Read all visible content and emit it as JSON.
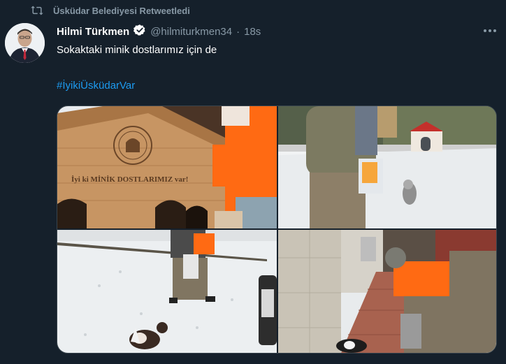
{
  "retweet": {
    "label": "Üsküdar Belediyesi Retweetledi",
    "icon": "retweet-icon"
  },
  "tweet": {
    "author_name": "Hilmi Türkmen",
    "verified": true,
    "handle": "@hilmiturkmen34",
    "separator": "·",
    "time": "18s",
    "text": "Sokaktaki minik dostlarımız için de",
    "hashtag": "#İyikiÜsküdarVar",
    "more_icon": "more-horizontal-icon"
  },
  "media": {
    "photos": [
      {
        "subject": "cat-house-close-up",
        "house_text": "İyi ki  MİNİK DOSTLARIMIZ  var!"
      },
      {
        "subject": "worker-with-food-bag"
      },
      {
        "subject": "worker-feeding-cat-in-snow"
      },
      {
        "subject": "worker-feeding-cat-on-sidewalk"
      }
    ]
  },
  "colors": {
    "background": "#15202b",
    "secondary_text": "#8899a6",
    "link": "#1d9bf0",
    "verified": "#ffffff"
  }
}
